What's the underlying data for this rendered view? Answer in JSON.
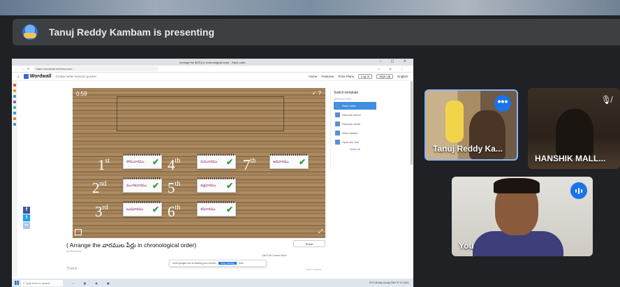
{
  "banner": {
    "presenter": "Tanuj Reddy Kambam is presenting"
  },
  "browser": {
    "tab_title": "Arrange the ${TE} in chronological order - Rank order",
    "url": "https://wordwall.net/resource/..."
  },
  "wordwall": {
    "logo": "Wordwall",
    "tagline": "Create better lessons quicker",
    "nav": [
      "Home",
      "Features",
      "Price Plans"
    ],
    "login": "Log in",
    "signup": "Sign Up",
    "language": "English"
  },
  "activity": {
    "timer": "0:59",
    "ranks": [
      {
        "num": "1",
        "suffix": "st",
        "day": "సోమవారము"
      },
      {
        "num": "2",
        "suffix": "nd",
        "day": "మంగళవారము"
      },
      {
        "num": "3",
        "suffix": "rd",
        "day": "బుధవారము"
      },
      {
        "num": "4",
        "suffix": "th",
        "day": "గురువారము"
      },
      {
        "num": "5",
        "suffix": "th",
        "day": "శుక్రవారము"
      },
      {
        "num": "6",
        "suffix": "th",
        "day": "శనివారము"
      },
      {
        "num": "7",
        "suffix": "th",
        "day": "ఆదివారము"
      }
    ],
    "title": "( Arrange the వారముల పేర్లు in chronological order)",
    "byline": "by Ramrededi",
    "share_label": "Share",
    "meta": "Like    Edit Content    More",
    "theme_label": "Theme",
    "login_report": "Log in required"
  },
  "templates": {
    "heading": "Switch template",
    "section": "INTERACTIVES",
    "items": [
      "Rank order",
      "Random wheel",
      "Random cards",
      "Word search",
      "Open the box"
    ],
    "more": "Show all"
  },
  "sharing_notice": {
    "text": "meet.google.com is sharing your screen.",
    "stop": "Stop sharing",
    "hide": "Hide"
  },
  "taskbar": {
    "search": "Type here to search",
    "tray": "29°C Mostly cloudy   ENG  07-07-2021"
  },
  "participants": [
    {
      "name": "Tanuj Reddy Ka..."
    },
    {
      "name": "HANSHIK MALL..."
    },
    {
      "name": "You"
    }
  ]
}
